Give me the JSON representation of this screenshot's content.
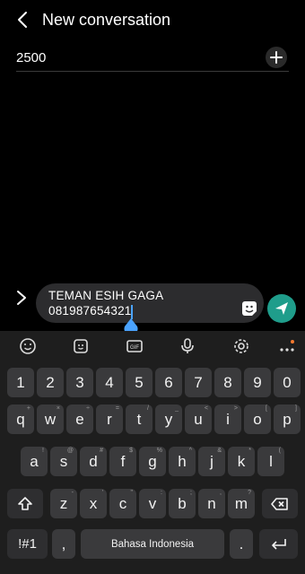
{
  "header": {
    "title": "New conversation"
  },
  "recipient": {
    "value": "2500"
  },
  "composer": {
    "line1": "TEMAN ESIH GAGA",
    "line2": "081987654321"
  },
  "keyboard": {
    "numbers": [
      "1",
      "2",
      "3",
      "4",
      "5",
      "6",
      "7",
      "8",
      "9",
      "0"
    ],
    "row1": [
      "q",
      "w",
      "e",
      "r",
      "t",
      "y",
      "u",
      "i",
      "o",
      "p"
    ],
    "row1_sup": [
      "+",
      "×",
      "÷",
      "=",
      "/",
      "_",
      "<",
      ">",
      "[",
      "]"
    ],
    "row2": [
      "a",
      "s",
      "d",
      "f",
      "g",
      "h",
      "j",
      "k",
      "l"
    ],
    "row2_sup": [
      "!",
      "@",
      "#",
      "$",
      "%",
      "^",
      "&",
      "*",
      "("
    ],
    "row3": [
      "z",
      "x",
      "c",
      "v",
      "b",
      "n",
      "m"
    ],
    "row3_sup": [
      "-",
      "'",
      "\"",
      ":",
      ";",
      ",",
      "?"
    ],
    "symbols_label": "!#1",
    "comma": ",",
    "space_label": "Bahasa Indonesia",
    "period": "."
  }
}
